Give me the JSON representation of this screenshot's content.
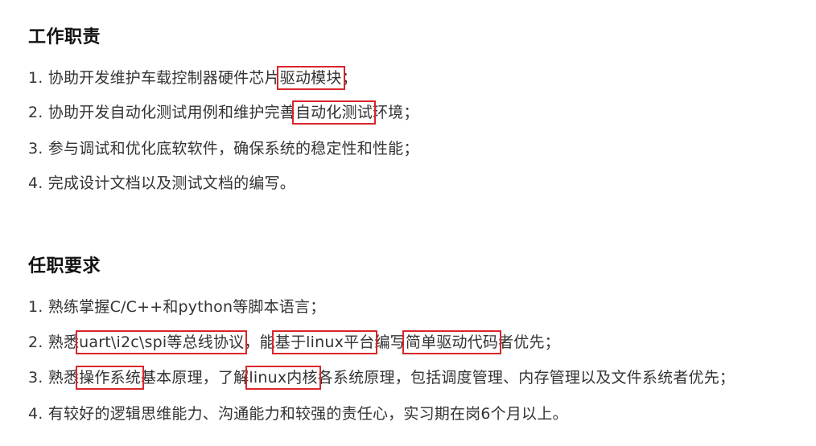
{
  "duties": {
    "title": "工作职责",
    "items": [
      {
        "a": "1. 协助开发维护车载控制器硬件芯片",
        "h1": "驱动模块",
        "b": "；"
      },
      {
        "a": "2. 协助开发自动化测试用例和维护完善",
        "h1": "自动化测试",
        "b": "环境；"
      },
      {
        "a": "3. 参与调试和优化底软软件，确保系统的稳定性和性能；"
      },
      {
        "a": "4. 完成设计文档以及测试文档的编写。"
      }
    ]
  },
  "requirements": {
    "title": "任职要求",
    "items": [
      {
        "a": "1. 熟练掌握C/C++和python等脚本语言；"
      },
      {
        "a": "2. 熟悉",
        "h1": "uart\\i2c\\spi等总线协议",
        "b": "，能",
        "h2": "基于linux平台",
        "c": "编写",
        "h3": "简单驱动代码",
        "d": "者优先；"
      },
      {
        "a": "3. 熟悉",
        "h1": "操作系统",
        "b": "基本原理，了解",
        "h2": "linux内核",
        "c": "各系统原理，包括调度管理、内存管理以及文件系统者优先；"
      },
      {
        "a": "4. 有较好的逻辑思维能力、沟通能力和较强的责任心，实习期在岗6个月以上。"
      }
    ]
  }
}
